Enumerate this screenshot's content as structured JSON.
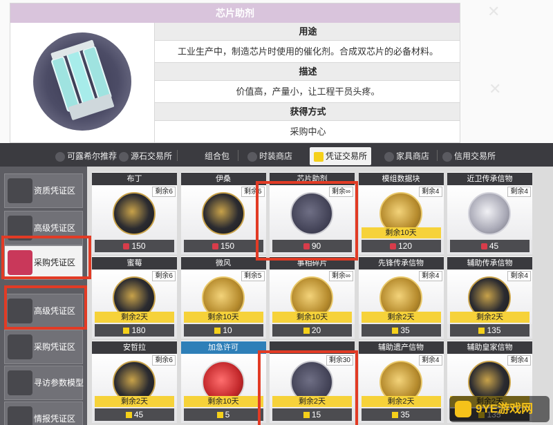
{
  "wiki": {
    "item_name": "芯片助剂",
    "sections": [
      {
        "heading": "用途",
        "text": "工业生产中，制造芯片时使用的催化剂。合成双芯片的必备材料。"
      },
      {
        "heading": "描述",
        "text": "价值高，产量小，让工程干员头疼。"
      },
      {
        "heading": "获得方式",
        "text": "采购中心"
      }
    ]
  },
  "shop": {
    "tabs": [
      {
        "label": "可露希尔推荐"
      },
      {
        "label": "源石交易所"
      },
      {
        "label": "组合包"
      },
      {
        "label": "时装商店"
      },
      {
        "label": "凭证交易所"
      },
      {
        "label": "家具商店"
      },
      {
        "label": "信用交易所"
      }
    ],
    "sidebar": [
      {
        "label": "资质凭证区"
      },
      {
        "label": "高级凭证区"
      },
      {
        "label": "采购凭证区"
      },
      {
        "label": "高级凭证区"
      },
      {
        "label": "采购凭证区"
      },
      {
        "label": "寻访参数模型"
      },
      {
        "label": "情报凭证区"
      }
    ],
    "cards": [
      {
        "title": "布丁",
        "remaining": "剩余6",
        "price": "150",
        "currency": "red",
        "days": ""
      },
      {
        "title": "伊桑",
        "remaining": "剩余6",
        "price": "150",
        "currency": "red",
        "days": ""
      },
      {
        "title": "芯片助剂",
        "remaining": "剩余∞",
        "price": "90",
        "currency": "red",
        "days": ""
      },
      {
        "title": "模组数据块",
        "remaining": "剩余4",
        "price": "120",
        "currency": "red",
        "days": "剩余10天"
      },
      {
        "title": "近卫传承信物",
        "remaining": "剩余4",
        "price": "45",
        "currency": "red",
        "days": ""
      },
      {
        "title": "蜜莓",
        "remaining": "剩余6",
        "price": "180",
        "currency": "yellow",
        "days": "剩余2天"
      },
      {
        "title": "微风",
        "remaining": "剩余5",
        "price": "10",
        "currency": "yellow",
        "days": "剩余10天"
      },
      {
        "title": "事相碎片",
        "remaining": "剩余∞",
        "price": "20",
        "currency": "yellow",
        "days": "剩余10天"
      },
      {
        "title": "先锋传承信物",
        "remaining": "剩余4",
        "price": "35",
        "currency": "yellow",
        "days": "剩余2天"
      },
      {
        "title": "辅助传承信物",
        "remaining": "剩余4",
        "price": "135",
        "currency": "yellow",
        "days": "剩余2天"
      },
      {
        "title": "安哲拉",
        "remaining": "剩余6",
        "price": "45",
        "currency": "yellow",
        "days": "剩余2天"
      },
      {
        "title": "加急许可",
        "remaining": "",
        "price": "5",
        "currency": "yellow",
        "days": "剩余10天"
      },
      {
        "title": "",
        "remaining": "剩余30",
        "price": "15",
        "currency": "yellow",
        "days": "剩余2天"
      },
      {
        "title": "辅助遗产信物",
        "remaining": "剩余4",
        "price": "35",
        "currency": "yellow",
        "days": "剩余2天"
      },
      {
        "title": "辅助皇家信物",
        "remaining": "剩余4",
        "price": "135",
        "currency": "yellow",
        "days": "剩余2天"
      }
    ]
  },
  "watermark": {
    "text": "9YE游戏网"
  },
  "colors": {
    "highlight_box": "#e23b25",
    "title_bar": "#d9c4dc",
    "voucher_yellow": "#f5d01a"
  }
}
